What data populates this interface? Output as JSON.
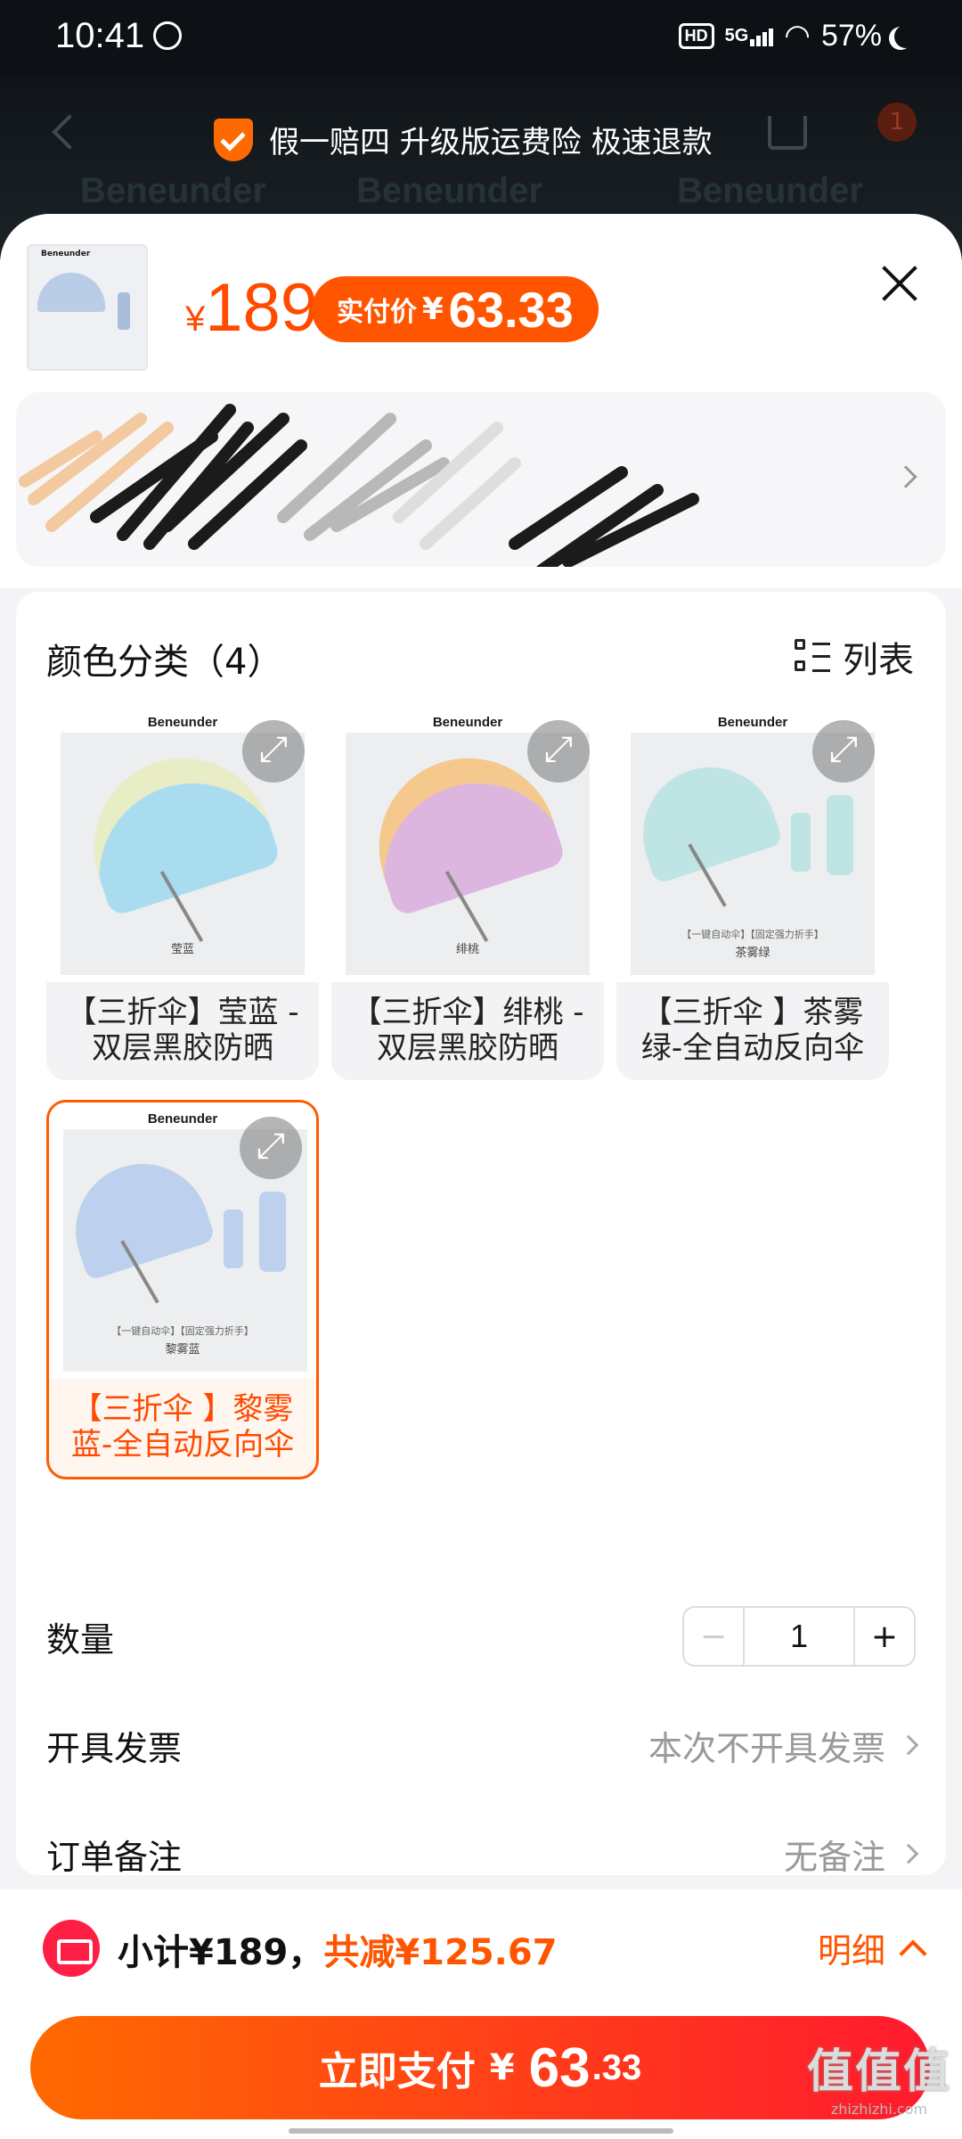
{
  "status_bar": {
    "time": "10:41",
    "hd": "HD",
    "network": "5G",
    "battery": "57%"
  },
  "header": {
    "brand_ghost": "Beneunder",
    "guarantee_text": "假一赔四 升级版运费险 极速退款",
    "cart_badge": "1"
  },
  "product": {
    "thumb_brand": "Beneunder",
    "price_currency": "¥",
    "price": "189",
    "paid_label": "实付价",
    "paid_currency": "¥",
    "paid_price": "63.33"
  },
  "sku_section": {
    "title": "颜色分类（4）",
    "view_toggle_label": "列表",
    "items": [
      {
        "name": "【三折伞】莹蓝 - 双层黑胶防晒",
        "brand": "Beneunder",
        "tag": "莹蓝",
        "subtag": "",
        "canopy": "#a9dcef",
        "rim": "#e9edc6",
        "selected": false
      },
      {
        "name": "【三折伞】绯桃 - 双层黑胶防晒",
        "brand": "Beneunder",
        "tag": "绯桃",
        "subtag": "",
        "canopy": "#dcb6de",
        "rim": "#f5c98e",
        "selected": false
      },
      {
        "name": "【三折伞 】茶雾绿-全自动反向伞",
        "brand": "Beneunder",
        "tag": "茶雾绿",
        "subtag": "【一键自动伞】【固定强力折手】",
        "canopy": "#bfe4e4",
        "rim": "#bfe4e4",
        "selected": false
      },
      {
        "name": "【三折伞 】黎雾蓝-全自动反向伞",
        "brand": "Beneunder",
        "tag": "黎雾蓝",
        "subtag": "【一键自动伞】【固定强力折手】",
        "canopy": "#bdd0ee",
        "rim": "#bdd0ee",
        "selected": true
      }
    ]
  },
  "quantity": {
    "label": "数量",
    "minus": "−",
    "value": "1",
    "plus": "+"
  },
  "invoice": {
    "label": "开具发票",
    "value": "本次不开具发票"
  },
  "remark": {
    "label": "订单备注",
    "value": "无备注"
  },
  "footer": {
    "subtotal_text": "小计¥189，",
    "discount_text": "共减¥125.67",
    "detail_label": "明细",
    "pay_label": "立即支付",
    "pay_currency": "¥",
    "pay_integer": "63",
    "pay_decimal": ".33"
  },
  "watermark": {
    "logo": "值值值",
    "site": "zhizhizhi.com"
  },
  "colors": {
    "accent": "#ff5500",
    "pay_gradient_start": "#ff6a00",
    "pay_gradient_end": "#ff1a2e"
  }
}
